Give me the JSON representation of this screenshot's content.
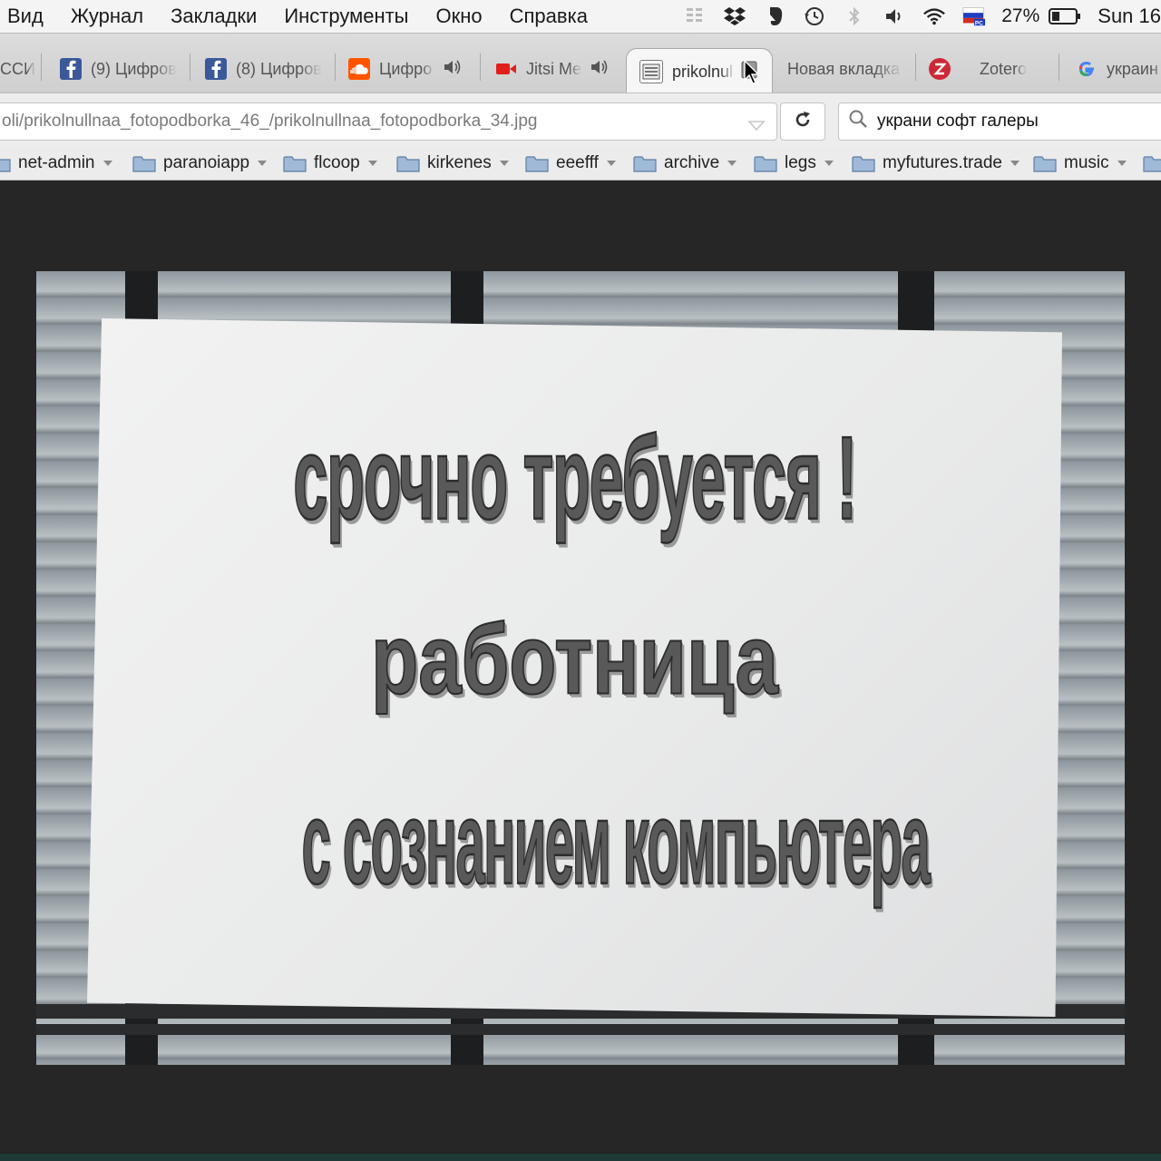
{
  "menubar": {
    "menus": [
      "Вид",
      "Журнал",
      "Закладки",
      "Инструменты",
      "Окно",
      "Справка"
    ],
    "battery_percent": "27%",
    "clock": "Sun 16",
    "tray_icons": [
      "menu-extra-icon",
      "dropbox-icon",
      "evernote-icon",
      "time-machine-icon",
      "bluetooth-icon",
      "volume-icon",
      "wifi-icon",
      "input-source-flag-icon",
      "battery-icon"
    ]
  },
  "tabs": [
    {
      "label": "ССИ",
      "favicon": "none"
    },
    {
      "label": "(9) Цифров",
      "favicon": "facebook-icon"
    },
    {
      "label": "(8) Цифров",
      "favicon": "facebook-icon"
    },
    {
      "label": "Цифро",
      "favicon": "soundcloud-icon",
      "audio": true
    },
    {
      "label": "Jitsi Me",
      "favicon": "jitsi-camera-icon",
      "audio": true
    },
    {
      "label": "prikolnul",
      "favicon": "image-thumbnail-icon",
      "active": true
    },
    {
      "label": "Новая вкладка",
      "favicon": "none"
    },
    {
      "label": "Zotero",
      "favicon": "zotero-icon"
    },
    {
      "label": "украин",
      "favicon": "google-icon"
    }
  ],
  "navbar": {
    "url": "oli/prikolnullnaa_fotopodborka_46_/prikolnullnaa_fotopodborka_34.jpg",
    "search_value": "украни софт галеры"
  },
  "bookmarks": [
    "net-admin",
    "paranoiapp",
    "flcoop",
    "kirkenes",
    "eeefff",
    "archive",
    "legs",
    "myfutures.trade",
    "music"
  ],
  "photo": {
    "sign_lines": [
      "срочно требуется !",
      "работница",
      "с сознанием компьютера"
    ]
  },
  "colors": {
    "facebook": "#3b5998",
    "soundcloud": "#ff5500",
    "jitsi": "#e0201b",
    "zotero": "#cc2936",
    "folder": "#9fb9d6",
    "page_background": "#262626"
  }
}
